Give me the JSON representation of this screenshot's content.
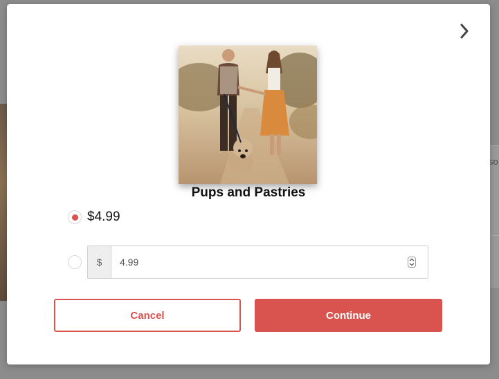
{
  "background": {
    "right_text": "so"
  },
  "modal": {
    "next_icon": "chevron-right-icon",
    "photo_alt": "couple-walking-dog-photo",
    "title": "Pups and Pastries",
    "options": {
      "fixed_price": "$4.99",
      "fixed_selected": true,
      "custom_currency": "$",
      "custom_amount": "4.99",
      "custom_selected": false
    },
    "buttons": {
      "cancel": "Cancel",
      "continue": "Continue"
    }
  },
  "colors": {
    "accent": "#d9534f",
    "overlay": "#8c8c8c"
  }
}
